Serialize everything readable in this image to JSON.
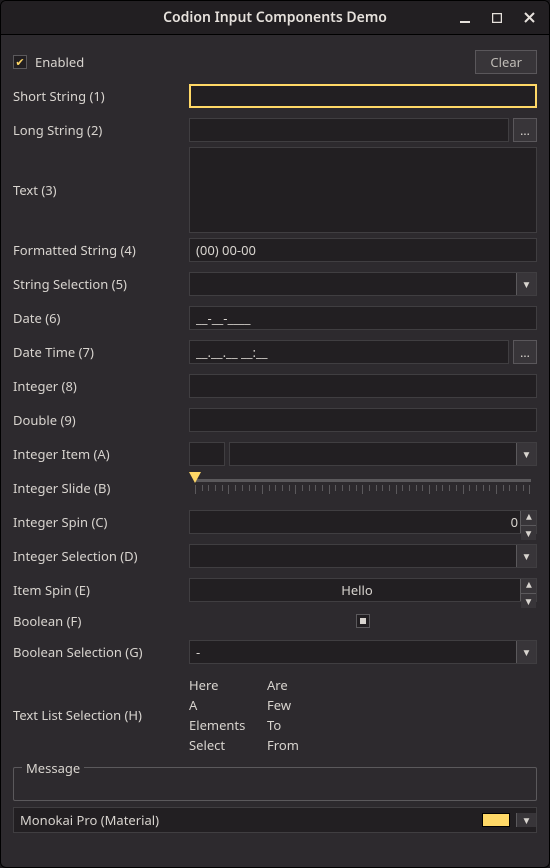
{
  "window": {
    "title": "Codion Input Components Demo"
  },
  "toolbar": {
    "enabled_label": "Enabled",
    "enabled_checked": true,
    "clear_label": "Clear"
  },
  "labels": {
    "short_string": "Short String (1)",
    "long_string": "Long String (2)",
    "text": "Text (3)",
    "formatted_string": "Formatted String (4)",
    "string_selection": "String Selection (5)",
    "date": "Date (6)",
    "date_time": "Date Time (7)",
    "integer": "Integer (8)",
    "double": "Double (9)",
    "integer_item": "Integer Item (A)",
    "integer_slide": "Integer Slide (B)",
    "integer_spin": "Integer Spin (C)",
    "integer_selection": "Integer Selection (D)",
    "item_spin": "Item Spin (E)",
    "boolean": "Boolean (F)",
    "boolean_selection": "Boolean Selection (G)",
    "text_list_selection": "Text List Selection (H)"
  },
  "values": {
    "short_string": "",
    "long_string": "",
    "text": "",
    "formatted_string": "(00) 00-00",
    "string_selection": "",
    "date": "__-__-____",
    "date_time": "__.__.__ __:__",
    "integer": "",
    "double": "",
    "integer_item_text": "",
    "integer_item_combo": "",
    "integer_spin": "0",
    "integer_selection": "",
    "item_spin": "Hello",
    "boolean_selection": "-"
  },
  "text_list": [
    "Here",
    "Are",
    "A",
    "Few",
    "Elements",
    "To",
    "Select",
    "From"
  ],
  "message": {
    "legend": "Message",
    "value": ""
  },
  "theme": {
    "name": "Monokai Pro (Material)",
    "swatch": "#ffd866"
  },
  "icons": {
    "dots": "...",
    "arrow_down": "▼",
    "arrow_up": "▲"
  }
}
